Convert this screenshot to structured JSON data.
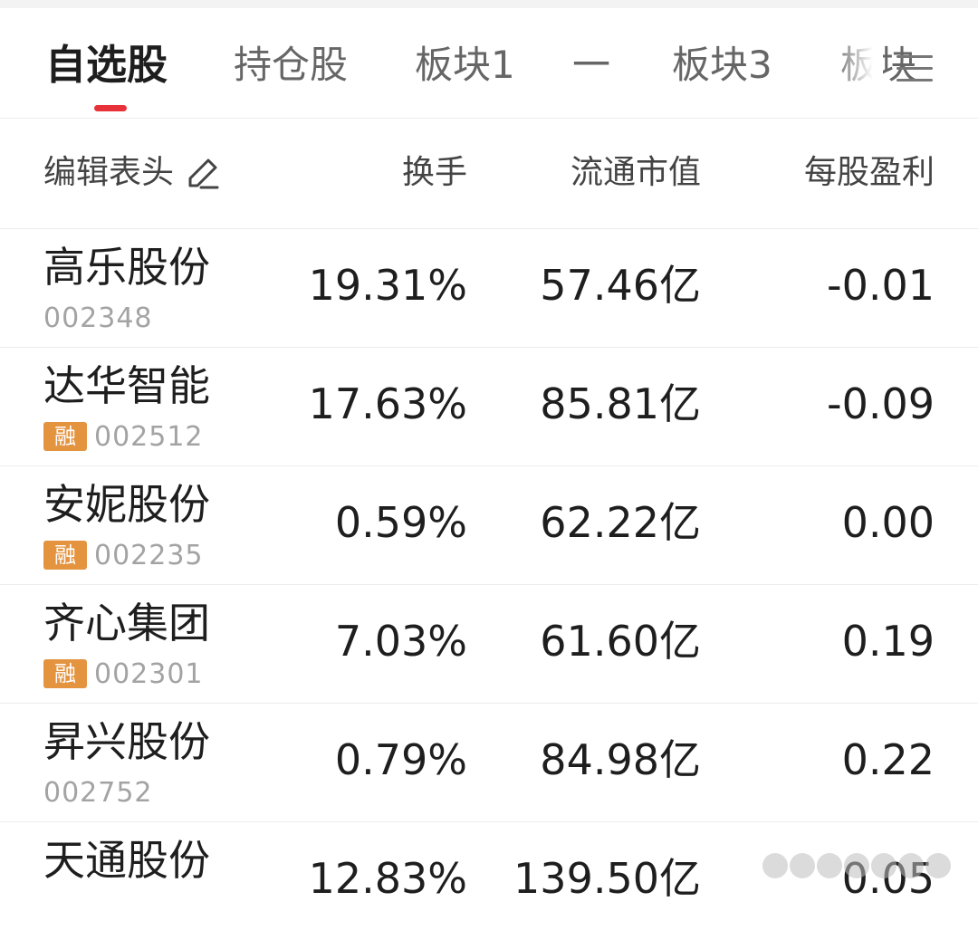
{
  "tabs": [
    {
      "label": "自选股",
      "active": true
    },
    {
      "label": "持仓股",
      "active": false
    },
    {
      "label": "板块1",
      "active": false
    },
    {
      "label": "一",
      "active": false
    },
    {
      "label": "板块3",
      "active": false
    },
    {
      "label": "板块",
      "active": false
    }
  ],
  "header": {
    "edit_label": "编辑表头",
    "columns": [
      "换手",
      "流通市值",
      "每股盈利"
    ]
  },
  "stocks": [
    {
      "name": "高乐股份",
      "code": "002348",
      "badge": "",
      "turnover": "19.31%",
      "float_cap": "57.46亿",
      "eps": "-0.01"
    },
    {
      "name": "达华智能",
      "code": "002512",
      "badge": "融",
      "turnover": "17.63%",
      "float_cap": "85.81亿",
      "eps": "-0.09"
    },
    {
      "name": "安妮股份",
      "code": "002235",
      "badge": "融",
      "turnover": "0.59%",
      "float_cap": "62.22亿",
      "eps": "0.00"
    },
    {
      "name": "齐心集团",
      "code": "002301",
      "badge": "融",
      "turnover": "7.03%",
      "float_cap": "61.60亿",
      "eps": "0.19"
    },
    {
      "name": "昇兴股份",
      "code": "002752",
      "badge": "",
      "turnover": "0.79%",
      "float_cap": "84.98亿",
      "eps": "0.22"
    },
    {
      "name": "天通股份",
      "code": "",
      "badge": "",
      "turnover": "12.83%",
      "float_cap": "139.50亿",
      "eps": "0.05"
    }
  ],
  "colors": {
    "accent": "#e8323a",
    "badge": "#e4933f",
    "code_text": "#a3a3a3"
  }
}
